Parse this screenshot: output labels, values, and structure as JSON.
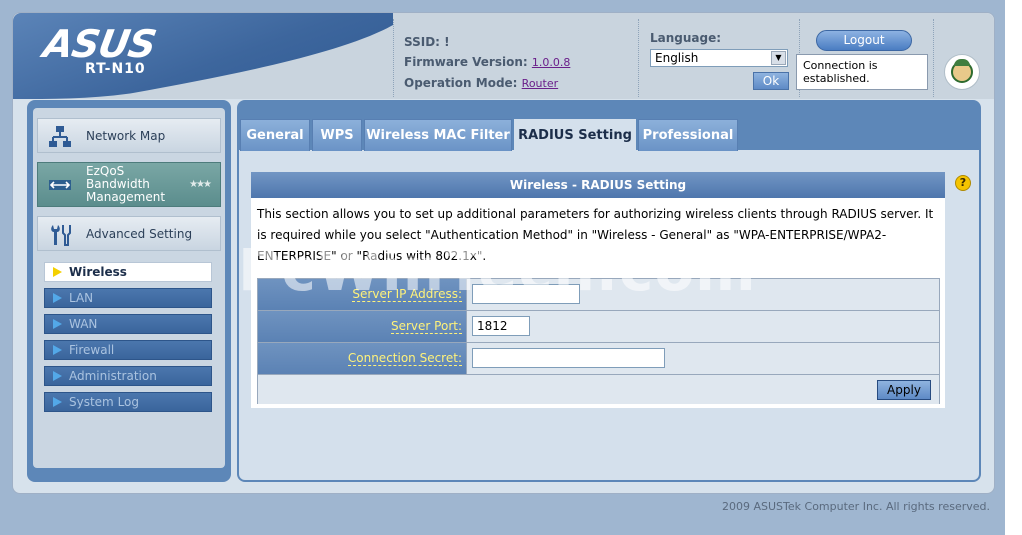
{
  "header": {
    "logo_text": "ASUS",
    "model": "RT-N10",
    "ssid_label": "SSID:",
    "ssid_value": "!",
    "firmware_label": "Firmware Version:",
    "firmware_value": "1.0.0.8",
    "opmode_label": "Operation Mode:",
    "opmode_value": "Router",
    "language_label": "Language:",
    "language_value": "English",
    "ok_label": "Ok",
    "logout_label": "Logout",
    "connection_status": "Connection is established."
  },
  "sidebar": {
    "main_items": [
      {
        "label": "Network Map",
        "icon": "network-map-icon"
      },
      {
        "label": "EzQoS Bandwidth Management",
        "icon": "ezqos-icon"
      },
      {
        "label": "Advanced Setting",
        "icon": "tools-icon"
      }
    ],
    "sub_items": [
      {
        "label": "Wireless",
        "active": true
      },
      {
        "label": "LAN",
        "active": false
      },
      {
        "label": "WAN",
        "active": false
      },
      {
        "label": "Firewall",
        "active": false
      },
      {
        "label": "Administration",
        "active": false
      },
      {
        "label": "System Log",
        "active": false
      }
    ]
  },
  "tabs": [
    {
      "label": "General",
      "active": false
    },
    {
      "label": "WPS",
      "active": false
    },
    {
      "label": "Wireless MAC Filter",
      "active": false
    },
    {
      "label": "RADIUS Setting",
      "active": true
    },
    {
      "label": "Professional",
      "active": false
    }
  ],
  "content": {
    "title": "Wireless - RADIUS Setting",
    "description": "This section allows you to set up additional parameters for authorizing wireless clients through RADIUS server. It is required while you select \"Authentication Method\" in \"Wireless - General\" as \"WPA-ENTERPRISE/WPA2-ENTERPRISE\" or \"Radius with 802.1x\".",
    "fields": [
      {
        "label": "Server IP Address:",
        "value": ""
      },
      {
        "label": "Server Port:",
        "value": "1812"
      },
      {
        "label": "Connection Secret:",
        "value": ""
      }
    ],
    "apply_label": "Apply",
    "help_symbol": "?"
  },
  "watermark": "PcWinTech.com",
  "footer": {
    "copyright": "2009 ASUSTek Computer Inc. All rights reserved."
  },
  "colors": {
    "accent_blue": "#5d87b8",
    "label_yellow": "#fff27a",
    "active_arrow": "#f4d000"
  }
}
